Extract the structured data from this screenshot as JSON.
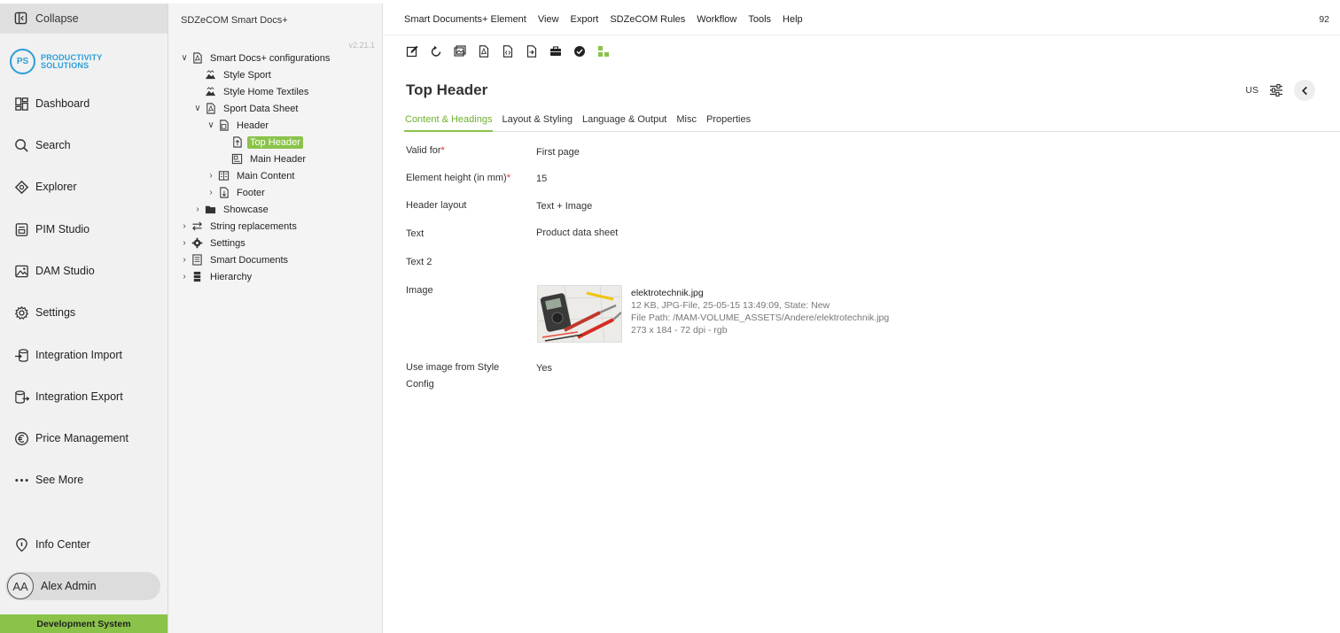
{
  "nav": {
    "collapse": "Collapse",
    "logo_initials": "PS",
    "logo_line1": "PRODUCTIVITY",
    "logo_line2": "SOLUTIONS",
    "items": [
      {
        "label": "Dashboard",
        "icon": "dashboard-icon"
      },
      {
        "label": "Search",
        "icon": "search-icon"
      },
      {
        "label": "Explorer",
        "icon": "explorer-icon"
      },
      {
        "label": "PIM Studio",
        "icon": "pim-studio-icon"
      },
      {
        "label": "DAM Studio",
        "icon": "dam-studio-icon"
      },
      {
        "label": "Settings",
        "icon": "settings-icon"
      },
      {
        "label": "Integration Import",
        "icon": "integration-import-icon"
      },
      {
        "label": "Integration Export",
        "icon": "integration-export-icon"
      },
      {
        "label": "Price Management",
        "icon": "euro-icon"
      },
      {
        "label": "See More",
        "icon": "more-icon"
      }
    ],
    "info_center": "Info Center",
    "user_initials": "AA",
    "user_name": "Alex Admin",
    "environment": "Development System"
  },
  "tree": {
    "title": "SDZeCOM Smart Docs+",
    "version": "v2.21.1",
    "nodes": [
      {
        "label": "Smart Docs+ configurations"
      },
      {
        "label": "Style Sport"
      },
      {
        "label": "Style Home Textiles"
      },
      {
        "label": "Sport Data Sheet"
      },
      {
        "label": "Header"
      },
      {
        "label": "Top Header"
      },
      {
        "label": "Main Header"
      },
      {
        "label": "Main Content"
      },
      {
        "label": "Footer"
      },
      {
        "label": "Showcase"
      },
      {
        "label": "String replacements"
      },
      {
        "label": "Settings"
      },
      {
        "label": "Smart Documents"
      },
      {
        "label": "Hierarchy"
      }
    ]
  },
  "menubar": {
    "items": [
      "Smart Documents+ Element",
      "View",
      "Export",
      "SDZeCOM Rules",
      "Workflow",
      "Tools",
      "Help"
    ],
    "count": "92"
  },
  "page": {
    "title": "Top Header",
    "language": "US"
  },
  "tabs": [
    "Content & Headings",
    "Layout & Styling",
    "Language & Output",
    "Misc",
    "Properties"
  ],
  "fields": {
    "valid_for": {
      "label": "Valid for",
      "value": "First page"
    },
    "element_height": {
      "label": "Element height (in mm)",
      "value": "15"
    },
    "header_layout": {
      "label": "Header layout",
      "value": "Text + Image"
    },
    "text": {
      "label": "Text",
      "value": "Product data sheet"
    },
    "text2": {
      "label": "Text 2",
      "value": ""
    },
    "image": {
      "label": "Image",
      "filename": "elektrotechnik.jpg",
      "info": "12 KB, JPG-File, 25-05-15 13:49:09, State: New",
      "path": "File Path: /MAM-VOLUME_ASSETS/Andere/elektrotechnik.jpg",
      "dimensions": "273 x 184 - 72 dpi - rgb"
    },
    "use_image_style": {
      "label_line1": "Use image from Style",
      "label_line2": "Config",
      "value": "Yes"
    }
  },
  "colors": {
    "accent": "#8bc34a",
    "logo": "#2a9fd8",
    "required": "#dd3333"
  }
}
